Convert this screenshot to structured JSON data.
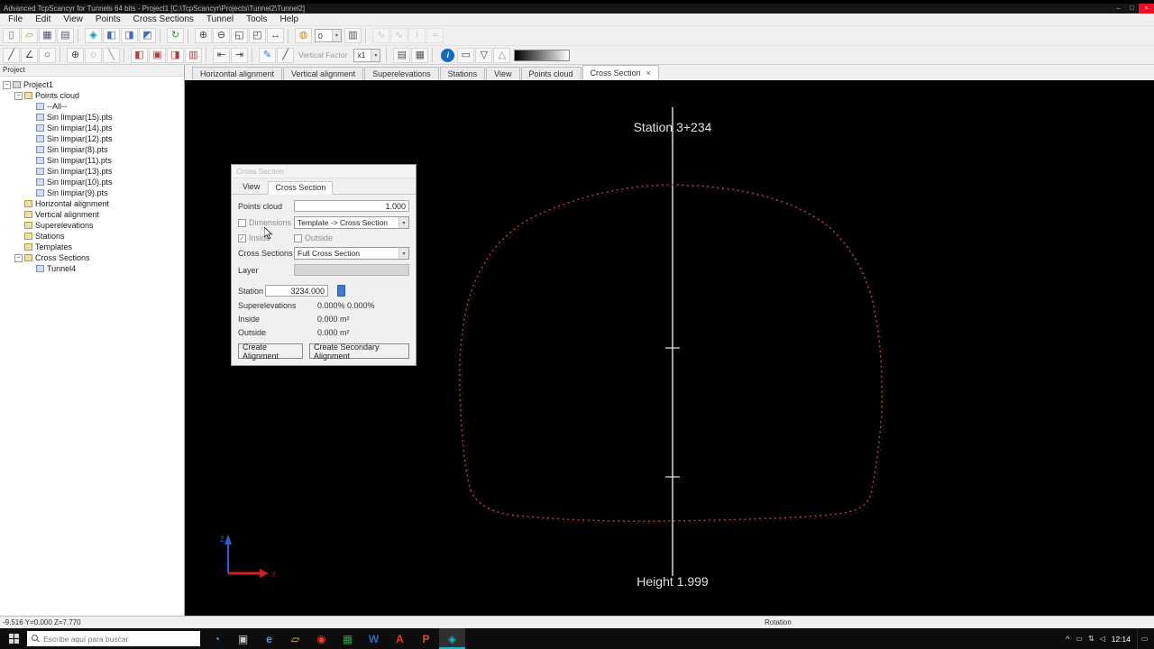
{
  "glyphs": {
    "dropdown_arrow": "▾",
    "check": "✓"
  },
  "titlebar": {
    "title": "Advanced TcpScancyr for Tunnels 64 bits - Project1 [C:\\TcpScancyr\\Projects\\Tunnel2\\Tunnel2]",
    "minimize": "–",
    "maximize": "□",
    "close": "×"
  },
  "menubar": {
    "items": [
      "File",
      "Edit",
      "View",
      "Points",
      "Cross Sections",
      "Tunnel",
      "Tools",
      "Help"
    ]
  },
  "toolbar_top": {
    "icons": [
      {
        "name": "new-file-icon",
        "glyph": "▯",
        "color": "#667"
      },
      {
        "name": "open-file-icon",
        "glyph": "▱",
        "color": "#c79b2e"
      },
      {
        "name": "save-icon",
        "glyph": "▦",
        "color": "#556"
      },
      {
        "name": "export-icon",
        "glyph": "▤",
        "color": "#556"
      },
      {
        "sep": true
      },
      {
        "name": "view-3d-cube-icon",
        "glyph": "◈",
        "color": "#0a9aa8"
      },
      {
        "name": "view-front-icon",
        "glyph": "◧",
        "color": "#3a6fc4"
      },
      {
        "name": "view-side-icon",
        "glyph": "◨",
        "color": "#3a6fc4"
      },
      {
        "name": "view-plan-icon",
        "glyph": "◩",
        "color": "#3a6fc4"
      },
      {
        "sep": true
      },
      {
        "name": "orbit-icon",
        "glyph": "↻",
        "color": "#2e9e3a"
      },
      {
        "sep": true
      },
      {
        "name": "zoom-in-icon",
        "glyph": "⊕",
        "color": "#445"
      },
      {
        "name": "zoom-out-icon",
        "glyph": "⊖",
        "color": "#445"
      },
      {
        "name": "zoom-window-icon",
        "glyph": "◱",
        "color": "#445"
      },
      {
        "name": "zoom-extents-icon",
        "glyph": "◰",
        "color": "#445"
      },
      {
        "name": "pan-icon",
        "glyph": "↔",
        "color": "#445"
      },
      {
        "sep": true
      },
      {
        "name": "light-icon",
        "glyph": "◍",
        "color": "#b79a00"
      },
      {
        "name": "light-level-combo",
        "combo": "0"
      },
      {
        "name": "capture-icon",
        "glyph": "▥",
        "color": "#556"
      },
      {
        "sep": true
      },
      {
        "name": "spline-1-icon",
        "glyph": "∿",
        "color": "#8899aa",
        "dim": true
      },
      {
        "name": "spline-2-icon",
        "glyph": "∿",
        "color": "#8899aa",
        "dim": true
      },
      {
        "name": "spline-3-icon",
        "glyph": "≀",
        "color": "#8899aa",
        "dim": true
      },
      {
        "name": "spline-4-icon",
        "glyph": "≈",
        "color": "#8899aa",
        "dim": true
      }
    ]
  },
  "toolbar_bottom": {
    "icons": [
      {
        "name": "draw-line-icon",
        "glyph": "╱",
        "color": "#445"
      },
      {
        "name": "draw-polyline-icon",
        "glyph": "∠",
        "color": "#445"
      },
      {
        "name": "draw-circle-icon",
        "glyph": "○",
        "color": "#445"
      },
      {
        "sep": true
      },
      {
        "name": "snap-center-icon",
        "glyph": "⊕",
        "color": "#445"
      },
      {
        "name": "snap-node-icon",
        "glyph": "◌",
        "color": "#445"
      },
      {
        "name": "offset-icon",
        "glyph": "╲",
        "color": "#889"
      },
      {
        "sep": true
      },
      {
        "name": "section-prev-icon",
        "glyph": "◧",
        "color": "#b04040"
      },
      {
        "name": "section-pick-icon",
        "glyph": "▣",
        "color": "#b04040"
      },
      {
        "name": "section-range-icon",
        "glyph": "◨",
        "color": "#b04040"
      },
      {
        "name": "section-all-icon",
        "glyph": "▥",
        "color": "#b04040"
      },
      {
        "sep": true
      },
      {
        "name": "step-back-icon",
        "glyph": "⇤",
        "color": "#445"
      },
      {
        "name": "step-forward-icon",
        "glyph": "⇥",
        "color": "#445"
      },
      {
        "sep": true
      },
      {
        "name": "edit-pencil-icon",
        "glyph": "✎",
        "color": "#3a6fc4"
      },
      {
        "name": "measure-icon",
        "glyph": "╱",
        "color": "#445"
      },
      {
        "name": "vertical-factor-label",
        "label": "Vertical Factor"
      },
      {
        "name": "vertical-factor-combo",
        "combo": "x1"
      },
      {
        "sep": true
      },
      {
        "name": "grid-small-icon",
        "glyph": "▤",
        "color": "#556"
      },
      {
        "name": "grid-large-icon",
        "glyph": "▦",
        "color": "#556"
      },
      {
        "sep": true
      },
      {
        "name": "station-info-icon",
        "glyph": "i",
        "color": "#1268c3",
        "circle": true
      },
      {
        "name": "display-icon",
        "glyph": "▭",
        "color": "#445"
      },
      {
        "name": "filter-icon",
        "glyph": "▽",
        "color": "#445"
      },
      {
        "name": "prism-icon",
        "glyph": "△",
        "color": "#88aa77"
      },
      {
        "name": "grayscale-gradient-bar",
        "gradient": true
      }
    ]
  },
  "tree": {
    "header": "Project",
    "expander_glyph": "−",
    "items": [
      {
        "label": "Project1",
        "level": 0,
        "exp": true,
        "icon": "root"
      },
      {
        "label": "Points cloud",
        "level": 1,
        "exp": true,
        "icon": "folder"
      },
      {
        "label": "--All--",
        "level": 2,
        "icon": "leaf"
      },
      {
        "label": "Sin limpiar(15).pts",
        "level": 2,
        "icon": "leaf"
      },
      {
        "label": "Sin limpiar(14).pts",
        "level": 2,
        "icon": "leaf"
      },
      {
        "label": "Sin limpiar(12).pts",
        "level": 2,
        "icon": "leaf"
      },
      {
        "label": "Sin limpiar(8).pts",
        "level": 2,
        "icon": "leaf"
      },
      {
        "label": "Sin limpiar(11).pts",
        "level": 2,
        "icon": "leaf"
      },
      {
        "label": "Sin limpiar(13).pts",
        "level": 2,
        "icon": "leaf"
      },
      {
        "label": "Sin limpiar(10).pts",
        "level": 2,
        "icon": "leaf"
      },
      {
        "label": "Sin limpiar(9).pts",
        "level": 2,
        "icon": "leaf"
      },
      {
        "label": "Horizontal alignment",
        "level": 1,
        "icon": "folder"
      },
      {
        "label": "Vertical alignment",
        "level": 1,
        "icon": "folder"
      },
      {
        "label": "Superelevations",
        "level": 1,
        "icon": "folder"
      },
      {
        "label": "Stations",
        "level": 1,
        "icon": "folder"
      },
      {
        "label": "Templates",
        "level": 1,
        "icon": "folder"
      },
      {
        "label": "Cross Sections",
        "level": 1,
        "exp": true,
        "icon": "folder"
      },
      {
        "label": "Tunnel4",
        "level": 2,
        "icon": "leaf"
      }
    ]
  },
  "tabs": {
    "close_glyph": "×",
    "items": [
      {
        "label": "Horizontal alignment"
      },
      {
        "label": "Vertical alignment"
      },
      {
        "label": "Superelevations"
      },
      {
        "label": "Stations"
      },
      {
        "label": "View"
      },
      {
        "label": "Points cloud"
      },
      {
        "label": "Cross Section",
        "active": true
      }
    ]
  },
  "dialog": {
    "title": "Cross Section",
    "tab_view": "View",
    "tab_cross_section": "Cross Section",
    "points_cloud_label": "Points cloud",
    "points_cloud_value": "1.000",
    "dimensions_label": "Dimensions",
    "dimensions_value": "Template -> Cross Section",
    "inside_check_label": "Inside",
    "outside_check_label": "Outside",
    "cross_sections_label": "Cross Sections",
    "cross_sections_value": "Full Cross Section",
    "layer_label": "Layer",
    "station_label": "Station",
    "station_value": "3234.000",
    "superelevations_label": "Superelevations",
    "superelevations_value": "0.000% 0.000%",
    "inside_area_label": "Inside",
    "inside_area_value": "0.000 m²",
    "outside_area_label": "Outside",
    "outside_area_value": "0.000 m²",
    "create_alignment_button": "Create Alignment",
    "create_secondary_alignment_button": "Create Secondary Alignment"
  },
  "canvas": {
    "station_label": "Station 3+234",
    "height_label": "Height 1.999",
    "axis_z_label": "Z",
    "axis_x_label": "X",
    "point_color": "#b04343"
  },
  "statusbar": {
    "coordinates": "-9.516 Y=0.000 Z=7.770",
    "mode": "Rotation"
  },
  "taskbar": {
    "search_placeholder": "Escribe aquí para buscar",
    "time": "12:14",
    "apps": [
      {
        "name": "cortana-icon",
        "glyph": "◔",
        "color": "#35a6e8"
      },
      {
        "name": "task-view-icon",
        "glyph": "▣",
        "color": "#c8c8c8"
      },
      {
        "name": "edge-icon",
        "glyph": "e",
        "color": "#3aa0e8",
        "bold": true
      },
      {
        "name": "file-explorer-icon",
        "glyph": "▱",
        "color": "#f2c23a"
      },
      {
        "name": "chrome-icon",
        "glyph": "◉",
        "color": "#e8432c"
      },
      {
        "name": "excel-icon",
        "glyph": "▦",
        "color": "#2f9e44"
      },
      {
        "name": "word-icon",
        "glyph": "W",
        "color": "#2f66c4",
        "bold": true
      },
      {
        "name": "acrobat-icon",
        "glyph": "A",
        "color": "#e03c31",
        "bold": true
      },
      {
        "name": "powerpoint-icon",
        "glyph": "P",
        "color": "#d8502e",
        "bold": true
      },
      {
        "name": "tcpscancyr-app-icon",
        "glyph": "◈",
        "color": "#18b6c9",
        "active": true
      }
    ],
    "tray": {
      "chevron": "^",
      "icons": [
        {
          "name": "tray-window-icon",
          "glyph": "▭"
        },
        {
          "name": "network-icon",
          "glyph": "⇅"
        },
        {
          "name": "volume-icon",
          "glyph": "◁"
        }
      ],
      "notification": "▭"
    }
  }
}
